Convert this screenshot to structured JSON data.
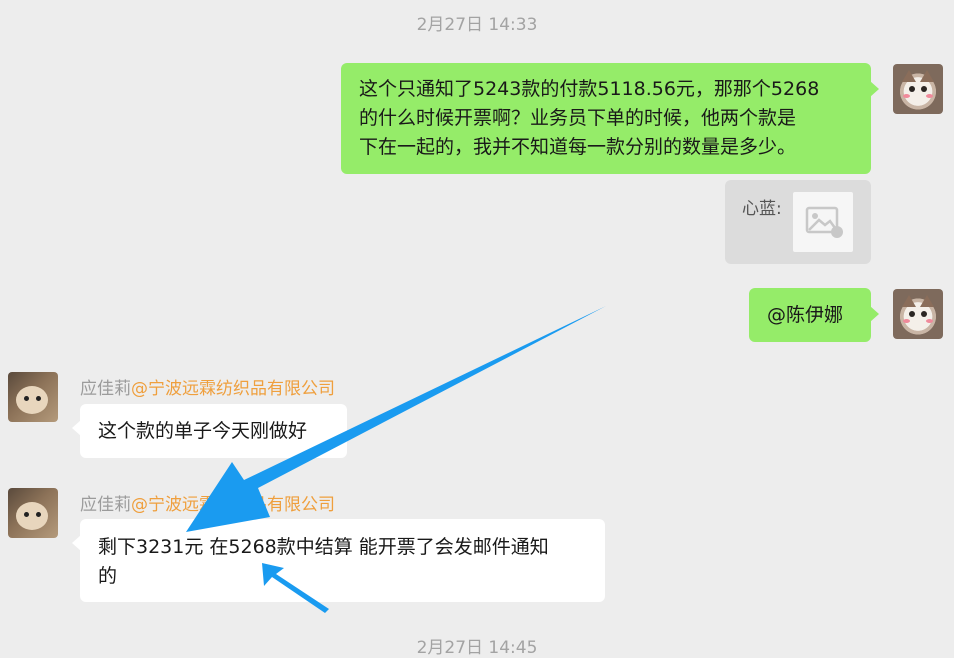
{
  "timestamp_top": "2月27日 14:33",
  "timestamp_bottom": "2月27日 14:45",
  "messages": {
    "out1_text": "这个只通知了5243款的付款5118.56元，那那个5268的什么时候开票啊？业务员下单的时候，他两个款是下在一起的，我并不知道每一款分别的数量是多少。",
    "out1_line1": "这个只通知了5243款的付款5118.56元，那那个5268",
    "out1_line2": "的什么时候开票啊？业务员下单的时候，他两个款是",
    "out1_line3": "下在一起的，我并不知道每一款分别的数量是多少。",
    "quote_name": "心蓝:",
    "out2_text": "@陈伊娜",
    "in1_sender_name": "应佳莉",
    "in1_sender_company": "@宁波远霖纺织品有限公司",
    "in1_text": "这个款的单子今天刚做好",
    "in2_sender_name": "应佳莉",
    "in2_sender_company": "@宁波远霖纺织品有限公司",
    "in2_line1": "剩下3231元 在5268款中结算 能开票了会发邮件通知",
    "in2_line2": "的"
  },
  "colors": {
    "background": "#ededed",
    "outgoing_bubble": "#95ec69",
    "incoming_bubble": "#ffffff",
    "company_text": "#ef9f3d",
    "annotation_arrow": "#1a9bf0"
  },
  "icons": {
    "quote_image": "image-placeholder-icon",
    "self_avatar": "cat-avatar",
    "contact_avatar": "hamster-avatar"
  }
}
